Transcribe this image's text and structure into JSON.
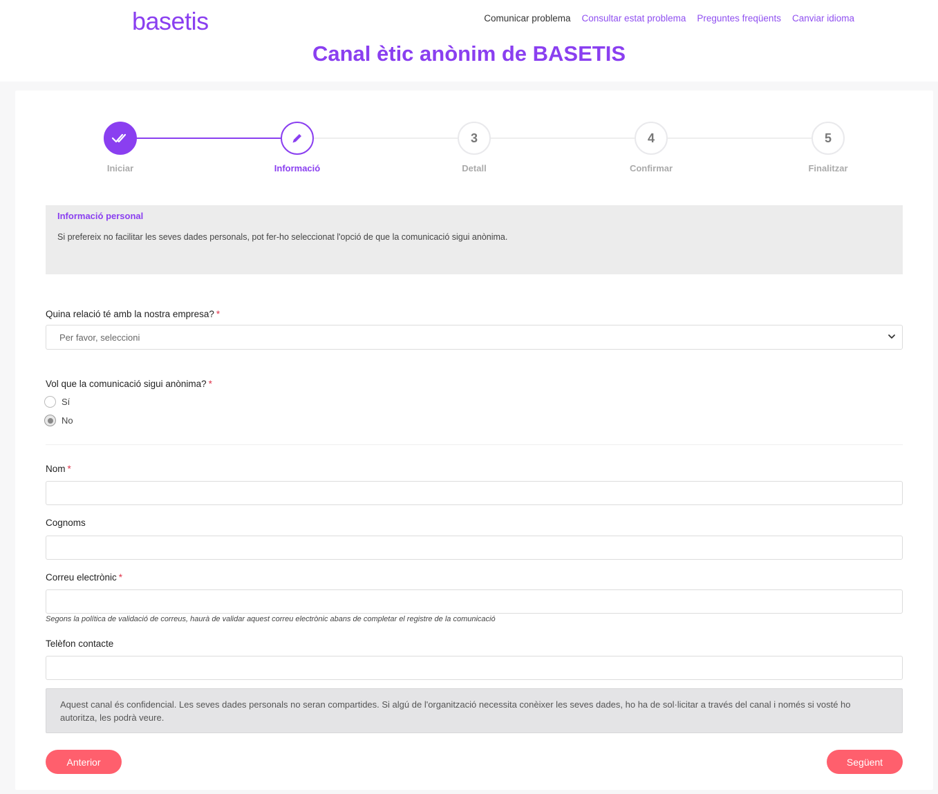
{
  "header": {
    "logo": "basetis",
    "nav": [
      {
        "label": "Comunicar problema",
        "active": true
      },
      {
        "label": "Consultar estat problema",
        "active": false
      },
      {
        "label": "Preguntes freqüents",
        "active": false
      },
      {
        "label": "Canviar idioma",
        "active": false
      }
    ],
    "title": "Canal ètic anònim de BASETIS"
  },
  "stepper": {
    "steps": [
      {
        "number": "",
        "label": "Iniciar",
        "status": "done",
        "icon": "double-check-icon"
      },
      {
        "number": "",
        "label": "Informació",
        "status": "current",
        "icon": "pencil-icon"
      },
      {
        "number": "3",
        "label": "Detall",
        "status": "pending"
      },
      {
        "number": "4",
        "label": "Confirmar",
        "status": "pending"
      },
      {
        "number": "5",
        "label": "Finalitzar",
        "status": "pending"
      }
    ]
  },
  "info": {
    "title": "Informació personal",
    "text": "Si prefereix no facilitar les seves dades personals, pot fer-ho seleccionat l'opció de que la comunicació sigui anònima."
  },
  "form": {
    "relation_label": "Quina relació té amb la nostra empresa?",
    "relation_placeholder": "Per favor, seleccioni",
    "anonymous_label": "Vol que la comunicació sigui anònima?",
    "anonymous_options": [
      {
        "label": "Sí",
        "checked": false
      },
      {
        "label": "No",
        "checked": true
      }
    ],
    "name_label": "Nom",
    "surname_label": "Cognoms",
    "email_label": "Correu electrònic",
    "email_help": "Segons la política de validació de correus, haurà de validar aquest correu electrònic abans de completar el registre de la comunicació",
    "phone_label": "Telèfon contacte",
    "required_mark": "*"
  },
  "notice": "Aquest canal és confidencial. Les seves dades personals no seran compartides. Si algú de l'organització necessita conèixer les seves dades, ho ha de sol·licitar a través del canal i només si vosté ho autoritza, les podrà veure.",
  "buttons": {
    "previous": "Anterior",
    "next": "Següent"
  },
  "colors": {
    "brand": "#8a3ff0",
    "button": "#ff5f6d"
  }
}
